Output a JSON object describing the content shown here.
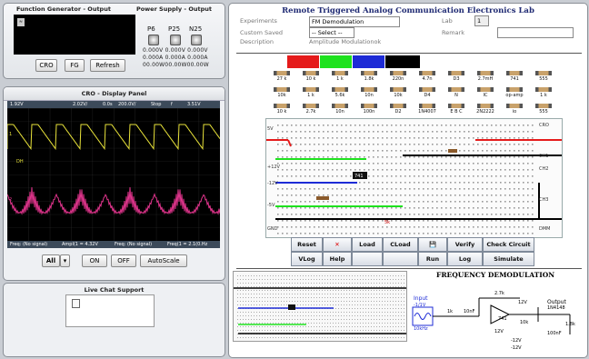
{
  "fg_panel": {
    "title": "Function Generator - Output",
    "buttons": [
      "CRO",
      "FG",
      "Refresh"
    ]
  },
  "ps_panel": {
    "title": "Power Supply - Output",
    "labels": [
      "P6",
      "P25",
      "N25"
    ],
    "rows": [
      "0.000V 0.000V 0.000V",
      "0.000A 0.000A 0.000A",
      "00.00W00.00W00.00W"
    ]
  },
  "cro_panel": {
    "title": "CRO - Display Panel",
    "top_status": [
      "1.92V",
      "2.02V/",
      "0.0s",
      "200.0V/",
      "Stop",
      "f",
      "3.51V"
    ],
    "bottom_status": [
      "Freq: (No signal)",
      "Ampl(1 = 4.32V",
      "Freq: (No signal)",
      "Freq(1 = 2.1(0.Hz"
    ],
    "markers": [
      "1",
      "2",
      "2",
      "DH"
    ],
    "channel_select": "All",
    "buttons": [
      "ON",
      "OFF",
      "AutoScale"
    ]
  },
  "chat": {
    "title": "Live Chat Support"
  },
  "main": {
    "title": "Remote Triggered Analog Communication Electronics Lab",
    "experiments_label": "Experiments",
    "experiment_value": "FM Demodulation",
    "lab_label": "Lab",
    "lab_value": "1",
    "custom_label": "Custom Saved",
    "custom_value": "-- Select --",
    "remark_label": "Remark",
    "description_label": "Description",
    "description_value": "Amplitude Modulationok"
  },
  "components": [
    {
      "label": "27 k"
    },
    {
      "label": "10 k"
    },
    {
      "label": "1 k"
    },
    {
      "label": "1.8k"
    },
    {
      "label": "220n"
    },
    {
      "label": "4.7n"
    },
    {
      "label": "D3"
    },
    {
      "label": "2.7mH"
    },
    {
      "label": "741"
    },
    {
      "label": "555"
    },
    {
      "label": "10k"
    },
    {
      "label": "1 k"
    },
    {
      "label": "5.6k"
    },
    {
      "label": "10n"
    },
    {
      "label": "10k"
    },
    {
      "label": "D4"
    },
    {
      "label": "N"
    },
    {
      "label": "IC"
    },
    {
      "label": "op-amp"
    },
    {
      "label": "1 k"
    },
    {
      "label": "10 k"
    },
    {
      "label": "2.7k"
    },
    {
      "label": "10n"
    },
    {
      "label": "100n"
    },
    {
      "label": "D2"
    },
    {
      "label": "1N4007"
    },
    {
      "label": "E B C"
    },
    {
      "label": "2N2222"
    },
    {
      "label": "io"
    },
    {
      "label": "555"
    }
  ],
  "board": {
    "left": [
      "5V",
      "+12V",
      "-12V",
      "-5V",
      "GND"
    ],
    "right": [
      "CRO",
      "CH1",
      "CH2",
      "CH3",
      "DMM"
    ],
    "ic_label": "741",
    "marker": "5k"
  },
  "toolbar": {
    "row1": [
      "Reset",
      "✕",
      "Load",
      "CLoad",
      "💾",
      "Verify",
      "Check Circuit"
    ],
    "row2": [
      "VLog",
      "Help",
      "",
      "",
      "Run",
      "Log",
      "Simulate"
    ]
  },
  "circuit": {
    "title": "FREQUENCY DEMODULATION",
    "input_label": "Input",
    "input_sub": "-1/1V",
    "freq_label": "10kHz",
    "values": [
      "1k",
      "10nF",
      "2.7k",
      "12V",
      "10k",
      "12V",
      "741",
      "-12V",
      "1N4148",
      "100nF",
      "1.8k",
      "-12V"
    ],
    "output_label": "Output"
  }
}
